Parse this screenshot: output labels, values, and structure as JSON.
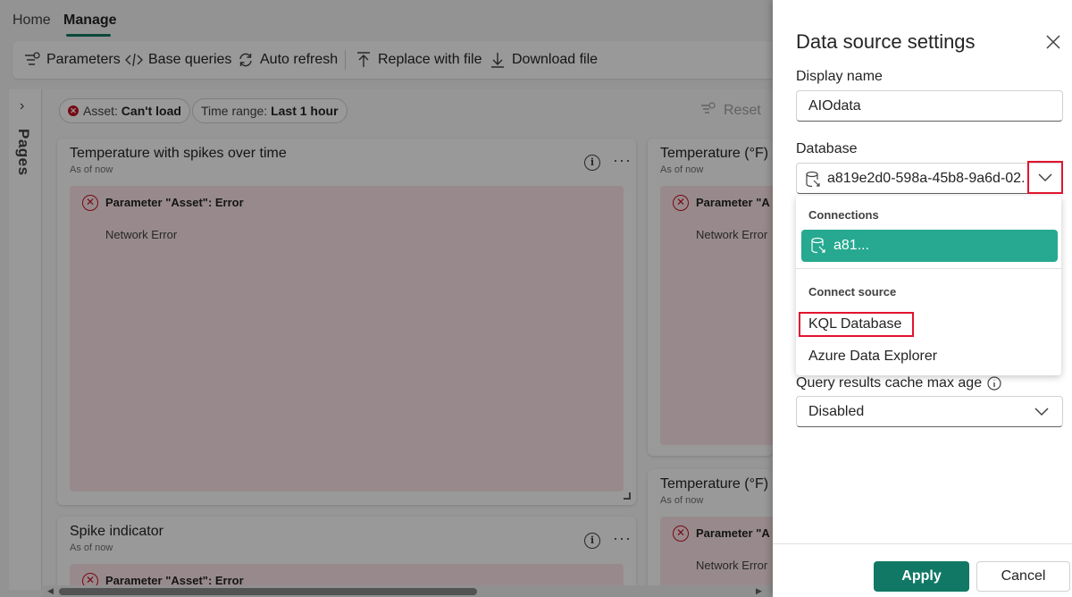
{
  "topnav": {
    "tabs": [
      {
        "label": "Home"
      },
      {
        "label": "Manage",
        "active": true
      }
    ]
  },
  "ribbon": {
    "parameters": "Parameters",
    "base_queries": "Base queries",
    "auto_refresh": "Auto refresh",
    "replace_with_file": "Replace with file",
    "download_file": "Download file"
  },
  "pages": {
    "label": "Pages"
  },
  "filters": {
    "asset_key": "Asset:",
    "asset_value": "Can't load",
    "time_key": "Time range:",
    "time_value": "Last 1 hour",
    "reset": "Reset"
  },
  "cards": [
    {
      "title": "Temperature with spikes over time",
      "subtitle": "As of now",
      "error_title": "Parameter \"Asset\": Error",
      "error_msg": "Network Error"
    },
    {
      "title": "Temperature (°F)",
      "subtitle": "As of now",
      "error_title": "Parameter \"A",
      "error_msg": "Network Error"
    },
    {
      "title": "Temperature (°F)",
      "subtitle": "As of now",
      "error_title": "Parameter \"A",
      "error_msg": "Network Error"
    },
    {
      "title": "Spike indicator",
      "subtitle": "As of now",
      "error_title": "Parameter \"Asset\": Error"
    }
  ],
  "panel": {
    "title": "Data source settings",
    "display_name_label": "Display name",
    "display_name_value": "AIOdata",
    "database_label": "Database",
    "database_value": "a819e2d0-598a-45b8-9a6d-02...",
    "dropdown": {
      "connections_header": "Connections",
      "connection_item": "a81...",
      "connect_source_header": "Connect source",
      "items": [
        "KQL Database",
        "Azure Data Explorer"
      ]
    },
    "cache_label": "Query results cache max age",
    "cache_value": "Disabled",
    "apply": "Apply",
    "cancel": "Cancel"
  },
  "colors": {
    "accent": "#117865",
    "selected": "#26a990",
    "highlight": "#e3132f",
    "error_bg": "#fde7e9",
    "error_icon": "#c50f1f"
  }
}
